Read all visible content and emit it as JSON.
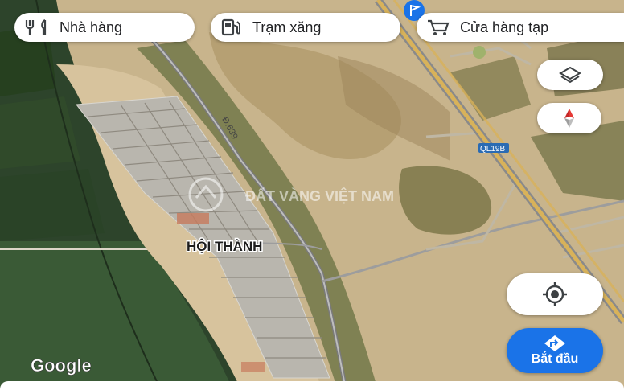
{
  "chips": [
    {
      "label": "Nhà hàng",
      "icon": "restaurant-icon"
    },
    {
      "label": "Trạm xăng",
      "icon": "gas-station-icon"
    },
    {
      "label": "Cửa hàng tạp",
      "icon": "cart-icon"
    }
  ],
  "map": {
    "place_label": "HỘI THÀNH",
    "road_label_1": "Đ.639",
    "road_label_2": "QL19B",
    "watermark": "ĐẤT VÀNG VIỆT NAM",
    "logo": "Google"
  },
  "buttons": {
    "layers_icon": "layers-icon",
    "compass_icon": "compass-icon",
    "my_location_icon": "my-location-icon",
    "start_label": "Bắt đầu",
    "start_icon": "directions-icon"
  },
  "colors": {
    "accent": "#1a73e8",
    "sand": "#cdb88f",
    "farmland": "#2f4a2e",
    "highway": "#d8b25a"
  }
}
